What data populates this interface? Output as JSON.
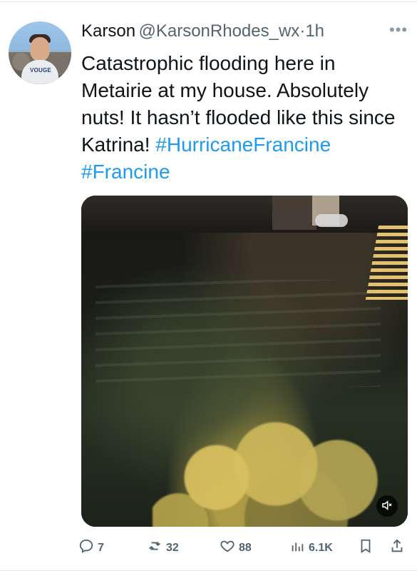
{
  "user": {
    "name": "Karson",
    "handle": "@KarsonRhodes_wx",
    "separator": "·",
    "time": "1h",
    "shirt_text": "VOUGE"
  },
  "tweet": {
    "text_part1": "Catastrophic flooding here in Metairie at my house. Absolutely nuts! It hasn’t flooded like this since Katrina!",
    "hashtag1": "#HurricaneFrancine",
    "hashtag2": "#Francine"
  },
  "actions": {
    "replies": "7",
    "reposts": "32",
    "likes": "88",
    "views": "6.1K"
  },
  "icons": {
    "more": "more-horizontal-icon",
    "mute": "speaker-mute-icon",
    "reply": "reply-icon",
    "repost": "repost-icon",
    "like": "heart-icon",
    "views": "views-icon",
    "bookmark": "bookmark-icon",
    "share": "share-icon"
  },
  "colors": {
    "text": "#0f1419",
    "secondary": "#536471",
    "link": "#1d9bf0"
  }
}
